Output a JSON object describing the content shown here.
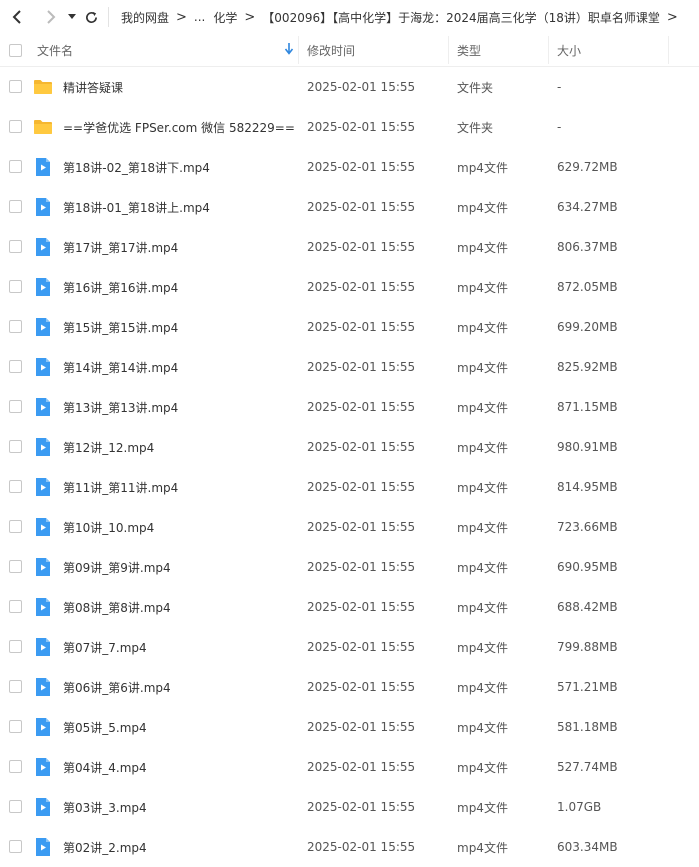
{
  "breadcrumb": {
    "items": [
      "我的网盘",
      "...",
      "化学",
      "【002096】【高中化学】于海龙：2024届高三化学（18讲）职卓名师课堂"
    ]
  },
  "header": {
    "name": "文件名",
    "modified": "修改时间",
    "type": "类型",
    "size": "大小"
  },
  "files": [
    {
      "name": "精讲答疑课",
      "time": "2025-02-01 15:55",
      "type": "文件夹",
      "size": "-",
      "icon": "folder-icon"
    },
    {
      "name": "==学爸优选 FPSer.com 微信 582229==",
      "time": "2025-02-01 15:55",
      "type": "文件夹",
      "size": "-",
      "icon": "folder-icon"
    },
    {
      "name": "第18讲-02_第18讲下.mp4",
      "time": "2025-02-01 15:55",
      "type": "mp4文件",
      "size": "629.72MB",
      "icon": "video-file-icon"
    },
    {
      "name": "第18讲-01_第18讲上.mp4",
      "time": "2025-02-01 15:55",
      "type": "mp4文件",
      "size": "634.27MB",
      "icon": "video-file-icon"
    },
    {
      "name": "第17讲_第17讲.mp4",
      "time": "2025-02-01 15:55",
      "type": "mp4文件",
      "size": "806.37MB",
      "icon": "video-file-icon"
    },
    {
      "name": "第16讲_第16讲.mp4",
      "time": "2025-02-01 15:55",
      "type": "mp4文件",
      "size": "872.05MB",
      "icon": "video-file-icon"
    },
    {
      "name": "第15讲_第15讲.mp4",
      "time": "2025-02-01 15:55",
      "type": "mp4文件",
      "size": "699.20MB",
      "icon": "video-file-icon"
    },
    {
      "name": "第14讲_第14讲.mp4",
      "time": "2025-02-01 15:55",
      "type": "mp4文件",
      "size": "825.92MB",
      "icon": "video-file-icon"
    },
    {
      "name": "第13讲_第13讲.mp4",
      "time": "2025-02-01 15:55",
      "type": "mp4文件",
      "size": "871.15MB",
      "icon": "video-file-icon"
    },
    {
      "name": "第12讲_12.mp4",
      "time": "2025-02-01 15:55",
      "type": "mp4文件",
      "size": "980.91MB",
      "icon": "video-file-icon"
    },
    {
      "name": "第11讲_第11讲.mp4",
      "time": "2025-02-01 15:55",
      "type": "mp4文件",
      "size": "814.95MB",
      "icon": "video-file-icon"
    },
    {
      "name": "第10讲_10.mp4",
      "time": "2025-02-01 15:55",
      "type": "mp4文件",
      "size": "723.66MB",
      "icon": "video-file-icon"
    },
    {
      "name": "第09讲_第9讲.mp4",
      "time": "2025-02-01 15:55",
      "type": "mp4文件",
      "size": "690.95MB",
      "icon": "video-file-icon"
    },
    {
      "name": "第08讲_第8讲.mp4",
      "time": "2025-02-01 15:55",
      "type": "mp4文件",
      "size": "688.42MB",
      "icon": "video-file-icon"
    },
    {
      "name": "第07讲_7.mp4",
      "time": "2025-02-01 15:55",
      "type": "mp4文件",
      "size": "799.88MB",
      "icon": "video-file-icon"
    },
    {
      "name": "第06讲_第6讲.mp4",
      "time": "2025-02-01 15:55",
      "type": "mp4文件",
      "size": "571.21MB",
      "icon": "video-file-icon"
    },
    {
      "name": "第05讲_5.mp4",
      "time": "2025-02-01 15:55",
      "type": "mp4文件",
      "size": "581.18MB",
      "icon": "video-file-icon"
    },
    {
      "name": "第04讲_4.mp4",
      "time": "2025-02-01 15:55",
      "type": "mp4文件",
      "size": "527.74MB",
      "icon": "video-file-icon"
    },
    {
      "name": "第03讲_3.mp4",
      "time": "2025-02-01 15:55",
      "type": "mp4文件",
      "size": "1.07GB",
      "icon": "video-file-icon"
    },
    {
      "name": "第02讲_2.mp4",
      "time": "2025-02-01 15:55",
      "type": "mp4文件",
      "size": "603.34MB",
      "icon": "video-file-icon"
    }
  ],
  "colors": {
    "folder": "#F5B731",
    "video": "#3B9BF2",
    "accent": "#2E86DE"
  }
}
